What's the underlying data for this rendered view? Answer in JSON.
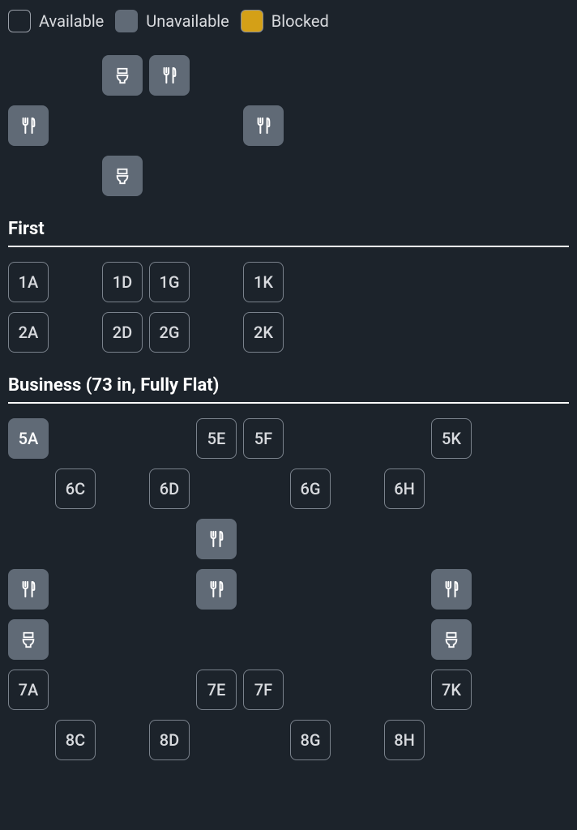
{
  "legend": {
    "available": "Available",
    "unavailable": "Unavailable",
    "blocked": "Blocked"
  },
  "sections": {
    "first": {
      "title": "First"
    },
    "business": {
      "title": "Business (73 in, Fully Flat)"
    }
  },
  "top_amenities": [
    {
      "type": "lavatory",
      "col": 3,
      "row": 1
    },
    {
      "type": "galley",
      "col": 4,
      "row": 1
    },
    {
      "type": "galley",
      "col": 1,
      "row": 2
    },
    {
      "type": "galley",
      "col": 6,
      "row": 2
    },
    {
      "type": "lavatory",
      "col": 3,
      "row": 3
    }
  ],
  "first_rows": [
    [
      {
        "label": "1A",
        "col": 1,
        "status": "available"
      },
      {
        "label": "1D",
        "col": 3,
        "status": "available"
      },
      {
        "label": "1G",
        "col": 4,
        "status": "available"
      },
      {
        "label": "1K",
        "col": 6,
        "status": "available"
      }
    ],
    [
      {
        "label": "2A",
        "col": 1,
        "status": "available"
      },
      {
        "label": "2D",
        "col": 3,
        "status": "available"
      },
      {
        "label": "2G",
        "col": 4,
        "status": "available"
      },
      {
        "label": "2K",
        "col": 6,
        "status": "available"
      }
    ]
  ],
  "business_rows": [
    [
      {
        "label": "5A",
        "col": 1,
        "status": "unavailable"
      },
      {
        "label": "5E",
        "col": 5,
        "status": "available"
      },
      {
        "label": "5F",
        "col": 6,
        "status": "available"
      },
      {
        "label": "5K",
        "col": 10,
        "status": "available"
      }
    ],
    [
      {
        "label": "6C",
        "col": 2,
        "status": "available"
      },
      {
        "label": "6D",
        "col": 4,
        "status": "available"
      },
      {
        "label": "6G",
        "col": 7,
        "status": "available"
      },
      {
        "label": "6H",
        "col": 9,
        "status": "available"
      }
    ]
  ],
  "business_amenities": [
    {
      "type": "galley",
      "col": 5,
      "row": 1
    },
    {
      "type": "galley",
      "col": 1,
      "row": 2
    },
    {
      "type": "galley",
      "col": 5,
      "row": 2
    },
    {
      "type": "galley",
      "col": 10,
      "row": 2
    },
    {
      "type": "lavatory",
      "col": 1,
      "row": 3
    },
    {
      "type": "lavatory",
      "col": 10,
      "row": 3
    }
  ],
  "business_rows2": [
    [
      {
        "label": "7A",
        "col": 1,
        "status": "available"
      },
      {
        "label": "7E",
        "col": 5,
        "status": "available"
      },
      {
        "label": "7F",
        "col": 6,
        "status": "available"
      },
      {
        "label": "7K",
        "col": 10,
        "status": "available"
      }
    ],
    [
      {
        "label": "8C",
        "col": 2,
        "status": "available"
      },
      {
        "label": "8D",
        "col": 4,
        "status": "available"
      },
      {
        "label": "8G",
        "col": 7,
        "status": "available"
      },
      {
        "label": "8H",
        "col": 9,
        "status": "available"
      }
    ]
  ]
}
